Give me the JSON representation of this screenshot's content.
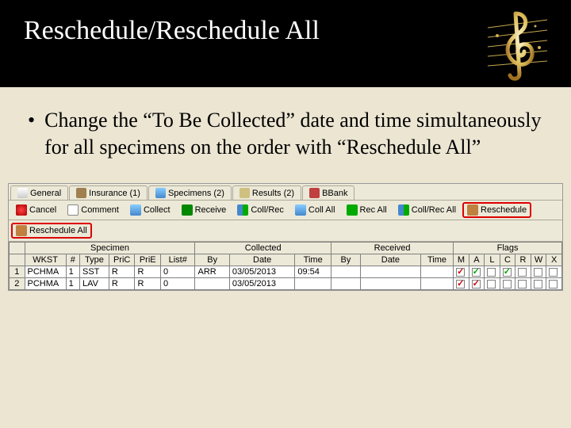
{
  "slide": {
    "title": "Reschedule/Reschedule All",
    "bullet": "Change the “To Be Collected” date and time simultaneously for all specimens on the order with “Reschedule All”"
  },
  "tabs": [
    {
      "label": "General"
    },
    {
      "label": "Insurance (1)"
    },
    {
      "label": "Specimens (2)"
    },
    {
      "label": "Results (2)"
    },
    {
      "label": "BBank"
    }
  ],
  "toolbar": [
    {
      "label": "Cancel"
    },
    {
      "label": "Comment"
    },
    {
      "label": "Collect"
    },
    {
      "label": "Receive"
    },
    {
      "label": "Coll/Rec"
    },
    {
      "label": "Coll All"
    },
    {
      "label": "Rec All"
    },
    {
      "label": "Coll/Rec All"
    },
    {
      "label": "Reschedule"
    }
  ],
  "toolbar2": {
    "reschedule_all": "Reschedule All"
  },
  "grid": {
    "groups": {
      "specimen": "Specimen",
      "collected": "Collected",
      "received": "Received",
      "flags": "Flags"
    },
    "cols": {
      "wkst": "WKST",
      "num": "#",
      "type": "Type",
      "pric": "PriC",
      "prie": "PriE",
      "listnum": "List#",
      "by_c": "By",
      "date_c": "Date",
      "time_c": "Time",
      "by_r": "By",
      "date_r": "Date",
      "time_r": "Time",
      "fM": "M",
      "fA": "A",
      "fL": "L",
      "fC": "C",
      "fR": "R",
      "fW": "W",
      "fX": "X"
    },
    "rows": [
      {
        "n": "1",
        "wkst": "PCHMA",
        "num": "1",
        "type": "SST",
        "pric": "R",
        "prie": "R",
        "listnum": "0",
        "by_c": "ARR",
        "date_c": "03/05/2013",
        "time_c": "09:54",
        "by_r": "",
        "date_r": "",
        "time_r": "",
        "flags": {
          "M": "red",
          "A": "green",
          "L": "",
          "C": "green",
          "R": "",
          "W": "",
          "X": ""
        }
      },
      {
        "n": "2",
        "wkst": "PCHMA",
        "num": "1",
        "type": "LAV",
        "pric": "R",
        "prie": "R",
        "listnum": "0",
        "by_c": "",
        "date_c": "03/05/2013",
        "time_c": "",
        "by_r": "",
        "date_r": "",
        "time_r": "",
        "flags": {
          "M": "red",
          "A": "red",
          "L": "",
          "C": "",
          "R": "",
          "W": "",
          "X": ""
        }
      }
    ]
  }
}
